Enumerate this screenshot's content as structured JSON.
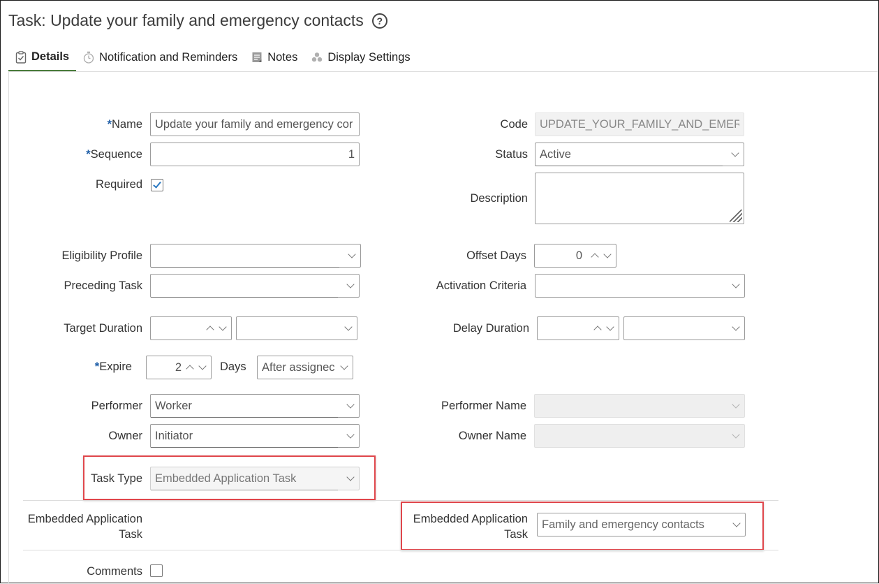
{
  "title": "Task: Update your family and emergency contacts",
  "tabs": [
    {
      "label": "Details",
      "icon": "clipboard-check-icon",
      "active": true
    },
    {
      "label": "Notification and Reminders",
      "icon": "stopwatch-icon",
      "active": false
    },
    {
      "label": "Notes",
      "icon": "notes-icon",
      "active": false
    },
    {
      "label": "Display Settings",
      "icon": "display-settings-icon",
      "active": false
    }
  ],
  "form": {
    "name": {
      "label": "Name",
      "value": "Update your family and emergency cor"
    },
    "sequence": {
      "label": "Sequence",
      "value": "1"
    },
    "required": {
      "label": "Required",
      "checked": true
    },
    "code": {
      "label": "Code",
      "value": "UPDATE_YOUR_FAMILY_AND_EMERGEI"
    },
    "status": {
      "label": "Status",
      "value": "Active"
    },
    "description": {
      "label": "Description",
      "value": ""
    },
    "eligibility_profile": {
      "label": "Eligibility Profile",
      "value": ""
    },
    "preceding_task": {
      "label": "Preceding Task",
      "value": ""
    },
    "offset_days": {
      "label": "Offset Days",
      "value": "0"
    },
    "activation_criteria": {
      "label": "Activation Criteria",
      "value": ""
    },
    "target_duration": {
      "label": "Target Duration",
      "value": "",
      "unit": ""
    },
    "delay_duration": {
      "label": "Delay Duration",
      "value": "",
      "unit": ""
    },
    "expire": {
      "label": "Expire",
      "value": "2",
      "unit_label": "Days",
      "when": "After assignec"
    },
    "performer": {
      "label": "Performer",
      "value": "Worker"
    },
    "performer_name": {
      "label": "Performer Name",
      "value": ""
    },
    "owner": {
      "label": "Owner",
      "value": "Initiator"
    },
    "owner_name": {
      "label": "Owner Name",
      "value": ""
    },
    "task_type": {
      "label": "Task Type",
      "value": "Embedded Application Task"
    },
    "embedded_section_label_line1": "Embedded Application",
    "embedded_section_label_line2": "Task",
    "embedded_app_task": {
      "label_line1": "Embedded Application",
      "label_line2": "Task",
      "value": "Family and emergency contacts"
    },
    "comments": {
      "label": "Comments",
      "checked": false
    }
  },
  "colors": {
    "required_star": "#1f5fa8",
    "active_tab_underline": "#4a7c3c",
    "highlight_box": "#e0474c",
    "checkmark": "#2b79c2"
  }
}
